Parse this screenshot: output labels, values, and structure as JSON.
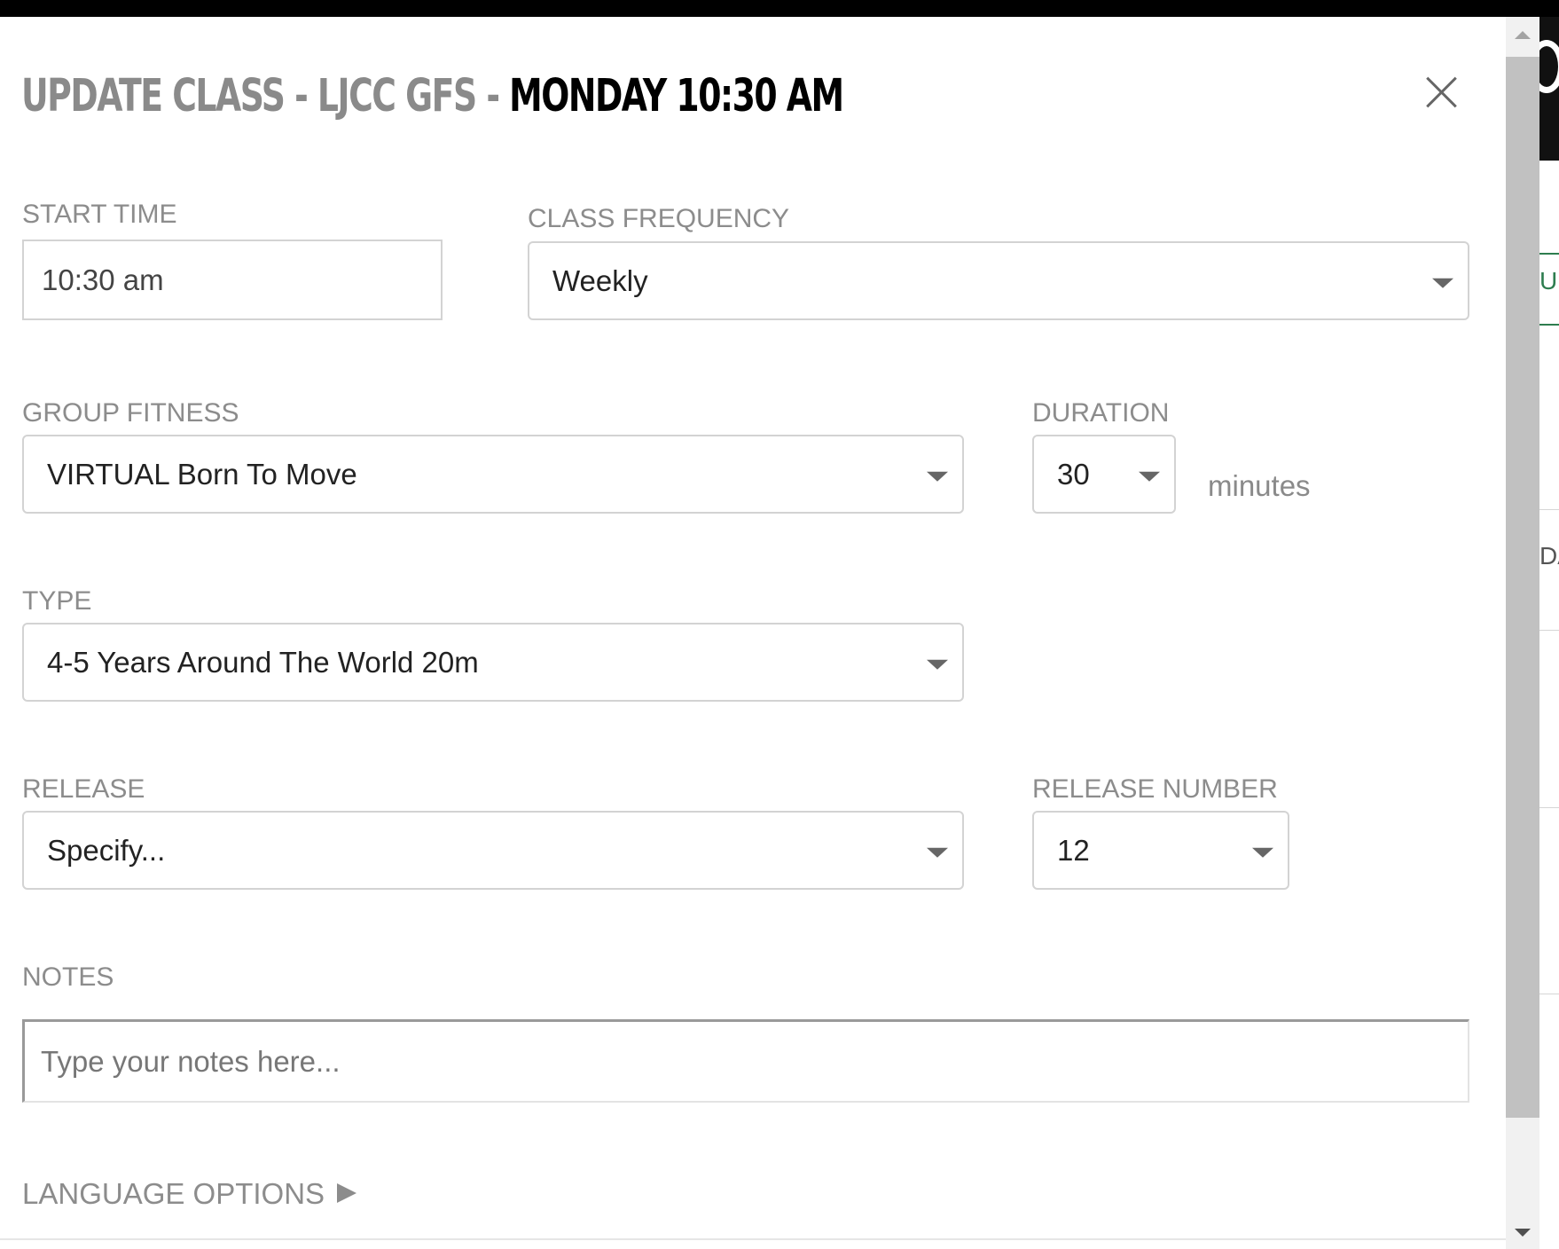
{
  "title": {
    "prefix": "UPDATE CLASS - LJCC GFS - ",
    "emphasis": "MONDAY 10:30 AM"
  },
  "close_icon": "close-x-icon",
  "form": {
    "start_time": {
      "label": "START TIME",
      "value": "10:30 am"
    },
    "class_frequency": {
      "label": "CLASS FREQUENCY",
      "value": "Weekly"
    },
    "group_fitness": {
      "label": "GROUP FITNESS",
      "value": "VIRTUAL Born To Move"
    },
    "duration": {
      "label": "DURATION",
      "value": "30",
      "unit": "minutes"
    },
    "type": {
      "label": "TYPE",
      "value": "4-5 Years Around The World 20m"
    },
    "release": {
      "label": "RELEASE",
      "value": "Specify..."
    },
    "release_number": {
      "label": "RELEASE NUMBER",
      "value": "12"
    },
    "notes": {
      "label": "NOTES",
      "placeholder": "Type your notes here..."
    }
  },
  "language_options": {
    "label": "LANGUAGE OPTIONS"
  },
  "colors": {
    "accent_green": "#2e7d4f",
    "label_gray": "#8c8c8c"
  }
}
